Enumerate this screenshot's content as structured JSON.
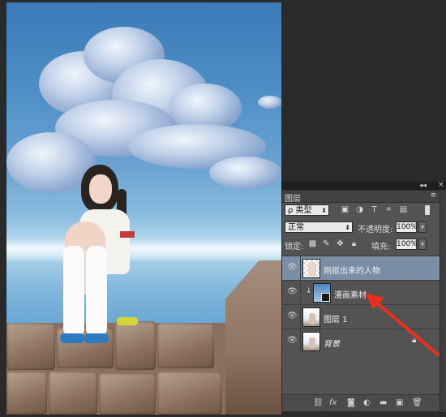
{
  "layers_panel": {
    "tab_label": "图层",
    "collapse_glyph": "◂◂",
    "close_glyph": "×",
    "menu_glyph": "≡",
    "filter": {
      "kind_label": "ρ 类型",
      "icons": [
        "image-filter-icon",
        "adjustment-filter-icon",
        "type-filter-icon",
        "shape-filter-icon",
        "smart-object-filter-icon"
      ]
    },
    "blend_mode": "正常",
    "opacity_label": "不透明度:",
    "opacity_value": "100%",
    "lock_label": "锁定:",
    "fill_label": "填充:",
    "fill_value": "100%",
    "layers": [
      {
        "name": "刚抠出来的人物",
        "visible": true,
        "selected": true,
        "clipped": false,
        "locked": false
      },
      {
        "name": "漫画素材",
        "visible": true,
        "selected": false,
        "clipped": true,
        "locked": false
      },
      {
        "name": "图层 1",
        "visible": true,
        "selected": false,
        "clipped": false,
        "locked": false
      },
      {
        "name": "背景",
        "visible": true,
        "selected": false,
        "clipped": false,
        "locked": true
      }
    ],
    "footer_labels": {
      "fx": "fx"
    }
  },
  "annotation": {
    "color": "#e8301c"
  }
}
